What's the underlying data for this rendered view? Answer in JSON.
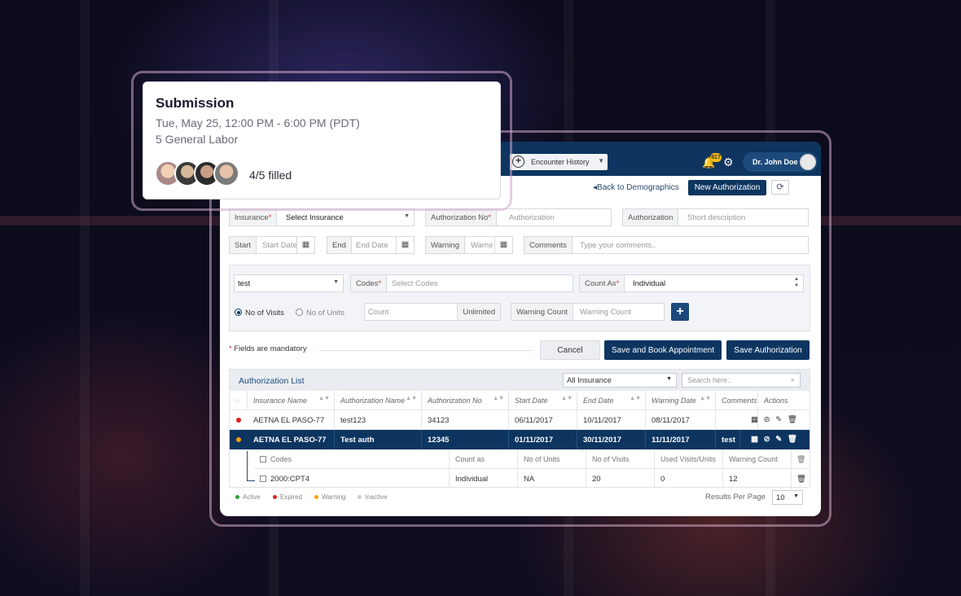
{
  "card": {
    "title": "Submission",
    "datetime": "Tue, May 25, 12:00 PM - 6:00 PM (PDT)",
    "role": "5 General Labor",
    "filled": "4/5 filled"
  },
  "topbar": {
    "encounter_label": "Encounter History",
    "notification_count": "817",
    "user_name": "Dr. John Doe"
  },
  "actions": {
    "back_link": "Back to Demographics",
    "new_authorization": "New Authorization"
  },
  "form": {
    "insurance_label": "Insurance",
    "insurance_value": "Select Insurance",
    "auth_no_label": "Authorization No",
    "auth_no_placeholder": "Authorization",
    "authorization_label": "Authorization",
    "authorization_placeholder": "Short description",
    "start_label": "Start",
    "start_placeholder": "Start Date",
    "end_label": "End",
    "end_placeholder": "End Date",
    "warning_label": "Warning",
    "warning_placeholder": "Warnir",
    "comments_label": "Comments",
    "comments_placeholder": "Type your comments.."
  },
  "codes_panel": {
    "type_value": "test",
    "codes_label": "Codes",
    "codes_placeholder": "Select Codes",
    "count_as_label": "Count As",
    "count_as_value": "Individual",
    "radio_visits": "No of Visits",
    "radio_units": "No of Units",
    "count_placeholder": "Count",
    "unlimited_label": "Unlimited",
    "warning_count_label": "Warning Count",
    "warning_count_placeholder": "Warning Count",
    "add_label": "+"
  },
  "footer_form": {
    "mandatory_note": "Fields are mandatory",
    "cancel": "Cancel",
    "save_book": "Save and Book Appointment",
    "save_auth": "Save Authorization"
  },
  "auth_list": {
    "title": "Authorization List",
    "filter_value": "All Insurance",
    "search_placeholder": "Search here..",
    "columns": [
      "Insurance Name",
      "Authorization Name",
      "Authorization No",
      "Start Date",
      "End Date",
      "Warning Date",
      "Comments",
      "Actions"
    ],
    "rows": [
      {
        "insurance": "AETNA EL PASO-77",
        "name": "test123",
        "number": "34123",
        "start": "06/11/2017",
        "end": "10/11/2017",
        "warning": "08/11/2017",
        "comments": "",
        "status_color": "#e02020"
      },
      {
        "insurance": "AETNA EL PASO-77",
        "name": "Test auth",
        "number": "12345",
        "start": "01/11/2017",
        "end": "30/11/2017",
        "warning": "11/11/2017",
        "comments": "test",
        "status_color": "#f5a000"
      }
    ],
    "sub_columns": [
      "Codes",
      "Count as",
      "No of Units",
      "No of Visits",
      "Used Visits/Units",
      "Warning Count"
    ],
    "sub_row": {
      "code": "2000:CPT4",
      "count_as": "Individual",
      "units": "NA",
      "visits": "20",
      "used": "0",
      "warning_count": "12"
    }
  },
  "legend": {
    "active": "Active",
    "expired": "Expired",
    "warning": "Warning",
    "inactive": "Inactive",
    "colors": {
      "active": "#2e9e3a",
      "expired": "#e02020",
      "warning": "#f5a000",
      "inactive": "#cccccc"
    }
  },
  "pagination": {
    "results_per_page_label": "Results Per Page",
    "results_per_page_value": "10"
  }
}
